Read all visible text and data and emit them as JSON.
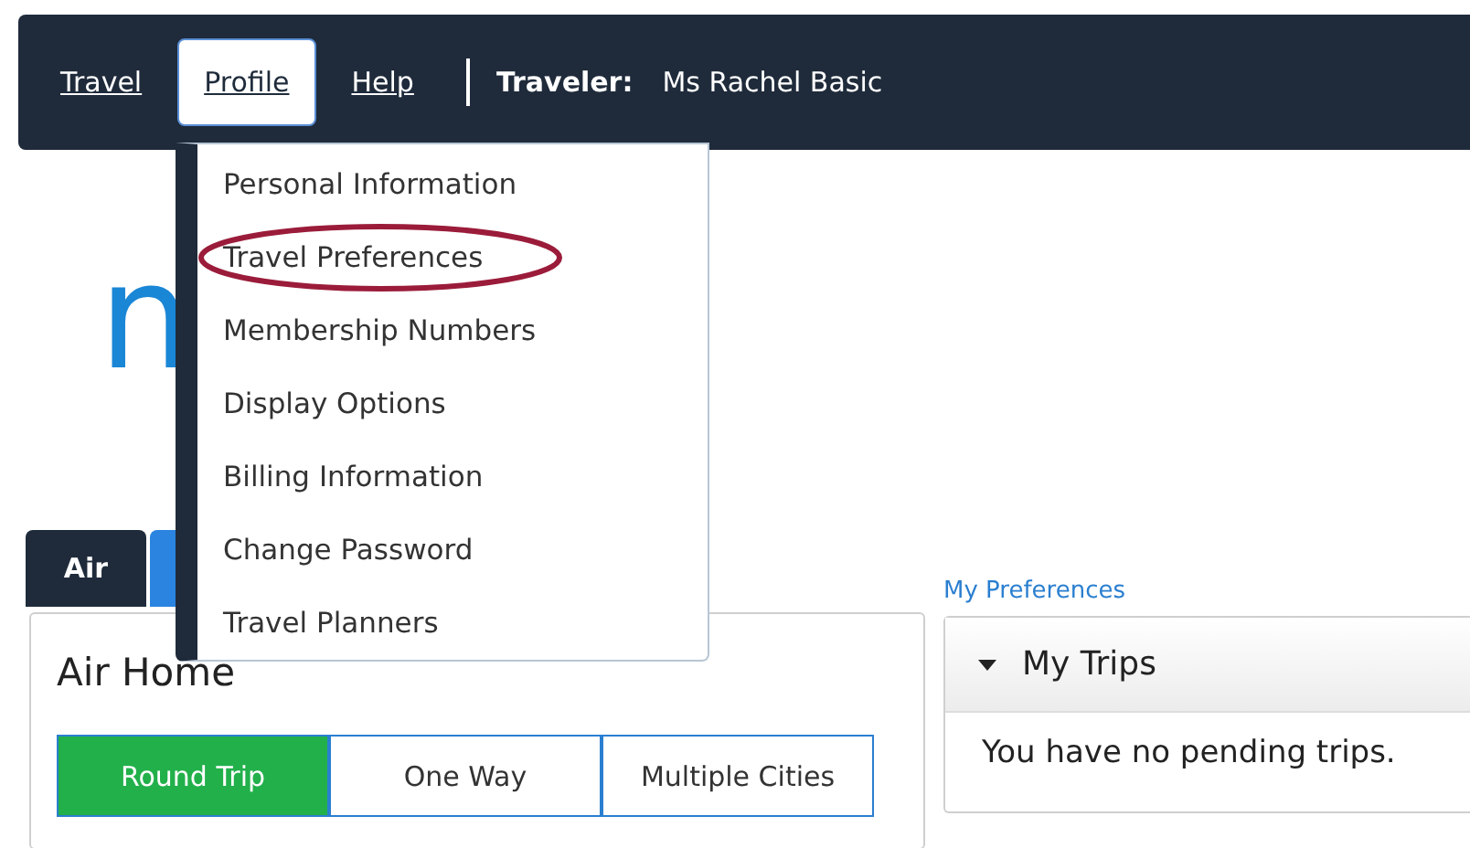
{
  "nav": {
    "items": [
      {
        "label": "Travel",
        "selected": false
      },
      {
        "label": "Profile",
        "selected": true
      },
      {
        "label": "Help",
        "selected": false
      }
    ],
    "traveler_label": "Traveler:",
    "traveler_name": "Ms Rachel Basic"
  },
  "profile_menu": [
    {
      "label": "Personal Information",
      "highlighted": false
    },
    {
      "label": "Travel Preferences",
      "highlighted": true
    },
    {
      "label": "Membership Numbers",
      "highlighted": false
    },
    {
      "label": "Display Options",
      "highlighted": false
    },
    {
      "label": "Billing Information",
      "highlighted": false
    },
    {
      "label": "Change Password",
      "highlighted": false
    },
    {
      "label": "Travel Planners",
      "highlighted": false
    }
  ],
  "page_heading": "n",
  "mode_tabs": [
    {
      "label": "Air",
      "selected": true
    },
    {
      "selected": false
    }
  ],
  "air_panel": {
    "title": "Air Home",
    "trip_types": [
      {
        "label": "Round Trip",
        "selected": true
      },
      {
        "label": "One Way",
        "selected": false
      },
      {
        "label": "Multiple Cities",
        "selected": false
      }
    ]
  },
  "preferences_link": "My Preferences",
  "trips_panel": {
    "title": "My Trips",
    "expanded": true,
    "message": "You have no pending trips."
  }
}
